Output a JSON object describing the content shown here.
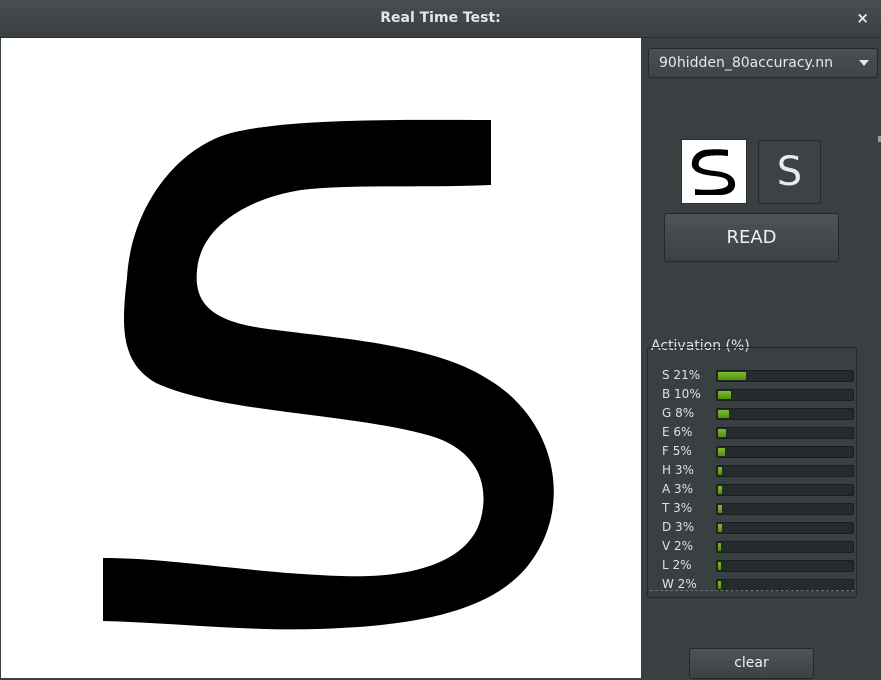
{
  "window": {
    "title": "Real Time Test:",
    "close_glyph": "×"
  },
  "model_select": {
    "selected": "90hidden_80accuracy.nn",
    "icon": "chevron-down-icon"
  },
  "prediction": {
    "letter": "S"
  },
  "read_button": {
    "label": "READ"
  },
  "activation": {
    "title": "Activation (%)",
    "bar_color": "#6bb01f",
    "items": [
      {
        "letter": "S",
        "percent": 21,
        "label": "S  21%"
      },
      {
        "letter": "B",
        "percent": 10,
        "label": "B  10%"
      },
      {
        "letter": "G",
        "percent": 8,
        "label": "G  8%"
      },
      {
        "letter": "E",
        "percent": 6,
        "label": "E  6%"
      },
      {
        "letter": "F",
        "percent": 5,
        "label": "F  5%"
      },
      {
        "letter": "H",
        "percent": 3,
        "label": "H  3%"
      },
      {
        "letter": "A",
        "percent": 3,
        "label": "A  3%"
      },
      {
        "letter": "T",
        "percent": 3,
        "label": "T  3%"
      },
      {
        "letter": "D",
        "percent": 3,
        "label": "D  3%"
      },
      {
        "letter": "V",
        "percent": 2,
        "label": "V  2%"
      },
      {
        "letter": "L",
        "percent": 2,
        "label": "L  2%"
      },
      {
        "letter": "W",
        "percent": 2,
        "label": "W  2%"
      }
    ]
  },
  "clear_button": {
    "label": "clear"
  }
}
